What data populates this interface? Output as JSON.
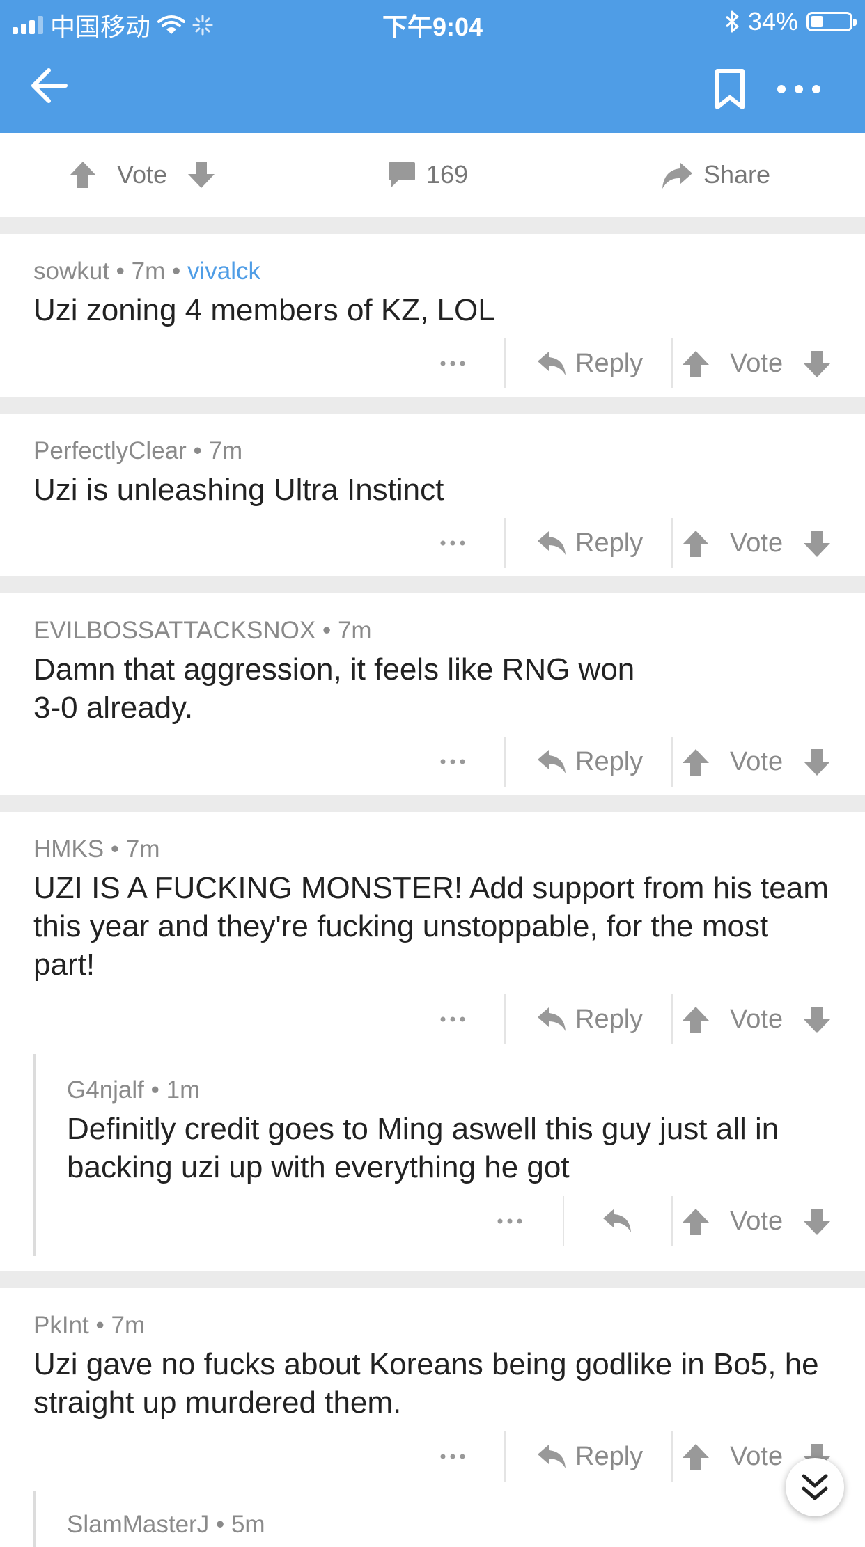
{
  "status_bar": {
    "carrier": "中国移动",
    "time": "下午9:04",
    "battery": "34%",
    "battery_level": 0.34
  },
  "post_actions": {
    "vote": "Vote",
    "comment_count": "169",
    "share": "Share"
  },
  "comments": [
    {
      "author": "sowkut",
      "age": "7m",
      "flair": "vivalck",
      "body": "Uzi zoning 4 members of KZ, LOL",
      "reply": "Reply",
      "vote": "Vote"
    },
    {
      "author": "PerfectlyClear",
      "age": "7m",
      "body": "Uzi is unleashing Ultra Instinct",
      "reply": "Reply",
      "vote": "Vote"
    },
    {
      "author": "EVILBOSSATTACKSNOX",
      "age": "7m",
      "body_line1": "Damn that aggression, it feels like RNG won",
      "body_line2": "3-0 already.",
      "reply": "Reply",
      "vote": "Vote"
    },
    {
      "author": "HMKS",
      "age": "7m",
      "body": "UZI IS A FUCKING MONSTER! Add support from his team this year and they're fucking unstoppable, for the most part!",
      "reply": "Reply",
      "vote": "Vote",
      "child": {
        "author": "G4njalf",
        "age": "1m",
        "body": "Definitly credit goes to Ming aswell this guy just all in backing uzi up with everything he got",
        "vote": "Vote"
      }
    },
    {
      "author": "PkInt",
      "age": "7m",
      "body": "Uzi gave no fucks about Koreans being godlike in Bo5, he straight up murdered them.",
      "reply": "Reply",
      "vote": "Vote",
      "child": {
        "author": "SlamMasterJ",
        "age": "5m"
      }
    }
  ],
  "separator": "•"
}
